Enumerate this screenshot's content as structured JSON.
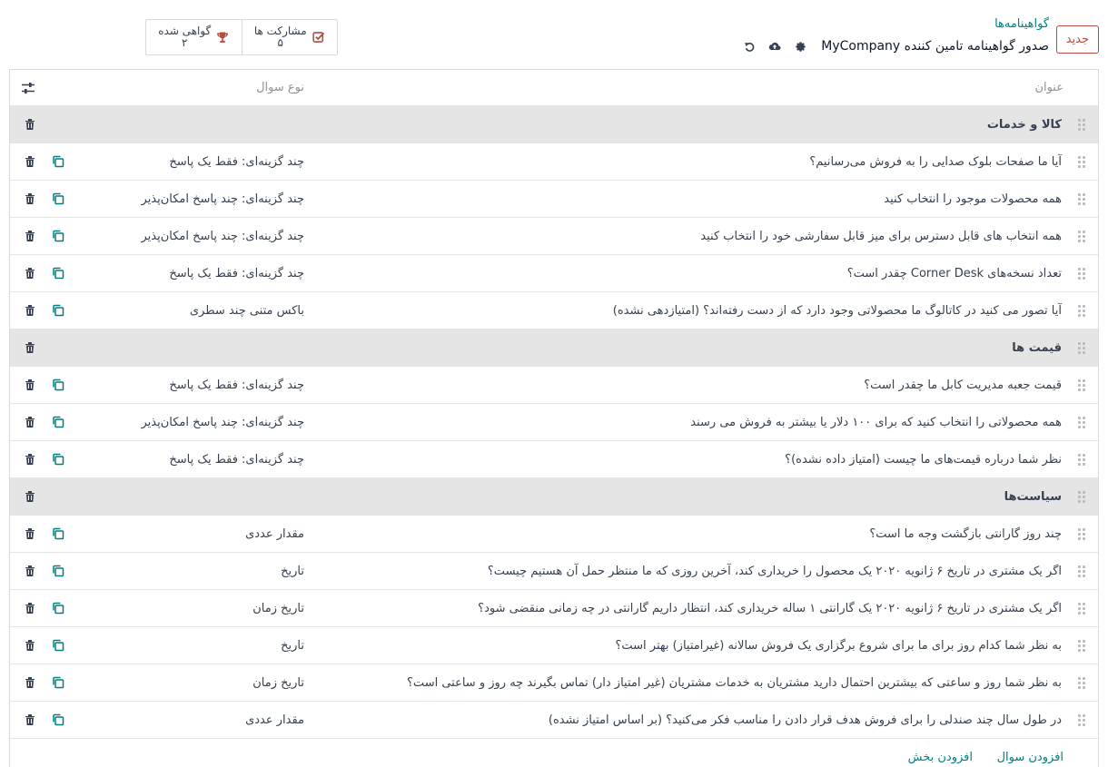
{
  "header": {
    "new_button": "جدید",
    "breadcrumb": "گواهینامه‌ها",
    "record_title": "صدور گواهینامه تامین کننده MyCompany",
    "icons": [
      "gear-icon",
      "cloud-upload-icon",
      "undo-icon"
    ]
  },
  "stats": {
    "certified_label": "گواهی شده",
    "certified_value": "۲",
    "participations_label": "مشارکت ها",
    "participations_value": "۵"
  },
  "table": {
    "col_title": "عنوان",
    "col_type": "نوع سوال",
    "rows": [
      {
        "kind": "section",
        "title": "کالا و خدمات"
      },
      {
        "kind": "question",
        "title": "آیا ما صفحات بلوک صدایی را به فروش می‌رسانیم؟",
        "type": "چند گزینه‌ای: فقط یک پاسخ"
      },
      {
        "kind": "question",
        "title": "همه محصولات موجود را انتخاب کنید",
        "type": "چند گزینه‌ای: چند پاسخ امکان‌پذیر"
      },
      {
        "kind": "question",
        "title": "همه انتخاب های قابل دسترس برای میز قابل سفارشی خود را انتخاب کنید",
        "type": "چند گزینه‌ای: چند پاسخ امکان‌پذیر"
      },
      {
        "kind": "question",
        "title": "تعداد نسخه‌های Corner Desk چقدر است؟",
        "type": "چند گزینه‌ای: فقط یک پاسخ"
      },
      {
        "kind": "question",
        "title": "آیا تصور می کنید در کاتالوگ ما محصولاتی وجود دارد که از دست رفته‌اند؟ (امتیازدهی نشده)",
        "type": "باکس متنی چند سطری"
      },
      {
        "kind": "section",
        "title": "قیمت ها"
      },
      {
        "kind": "question",
        "title": "قیمت جعبه مدیریت کابل ما چقدر است؟",
        "type": "چند گزینه‌ای: فقط یک پاسخ"
      },
      {
        "kind": "question",
        "title": "همه محصولاتی را انتخاب کنید که برای ۱۰۰ دلار یا بیشتر به فروش می رسند",
        "type": "چند گزینه‌ای: چند پاسخ امکان‌پذیر"
      },
      {
        "kind": "question",
        "title": "نظر شما درباره قیمت‌های ما چیست (امتیاز داده نشده)؟",
        "type": "چند گزینه‌ای: فقط یک پاسخ"
      },
      {
        "kind": "section",
        "title": "سیاست‌ها"
      },
      {
        "kind": "question",
        "title": "چند روز گارانتی بازگشت وجه ما است؟",
        "type": "مقدار عددی"
      },
      {
        "kind": "question",
        "title": "اگر یک مشتری در تاریخ ۶ ژانویه ۲۰۲۰ یک محصول را خریداری کند، آخرین روزی که ما منتظر حمل آن هستیم چیست؟",
        "type": "تاریخ"
      },
      {
        "kind": "question",
        "title": "اگر یک مشتری در تاریخ ۶ ژانویه ۲۰۲۰ یک گارانتی ۱ ساله خریداری کند، انتظار داریم گارانتی در چه زمانی منقضی شود؟",
        "type": "تاریخ زمان"
      },
      {
        "kind": "question",
        "title": "به نظر شما کدام روز برای ما برای شروع برگزاری یک فروش سالانه (غیرامتیاز) بهتر است؟",
        "type": "تاریخ"
      },
      {
        "kind": "question",
        "title": "به نظر شما روز و ساعتی که بیشترین احتمال دارید مشتریان به خدمات مشتریان (غیر امتیاز دار) تماس بگیرند چه روز و ساعتی است؟",
        "type": "تاریخ زمان"
      },
      {
        "kind": "question",
        "title": "در طول سال چند صندلی را برای فروش هدف قرار دادن را مناسب فکر می‌کنید؟ (بر اساس امتیاز نشده)",
        "type": "مقدار عددی"
      }
    ],
    "add_question": "افزودن سوال",
    "add_section": "افزودن بخش"
  },
  "colors": {
    "accent": "#017e84",
    "new_button": "#b84a40",
    "section_bg": "#e5e5e6",
    "trophy": "#b84a40",
    "checkbox": "#b84a40"
  }
}
